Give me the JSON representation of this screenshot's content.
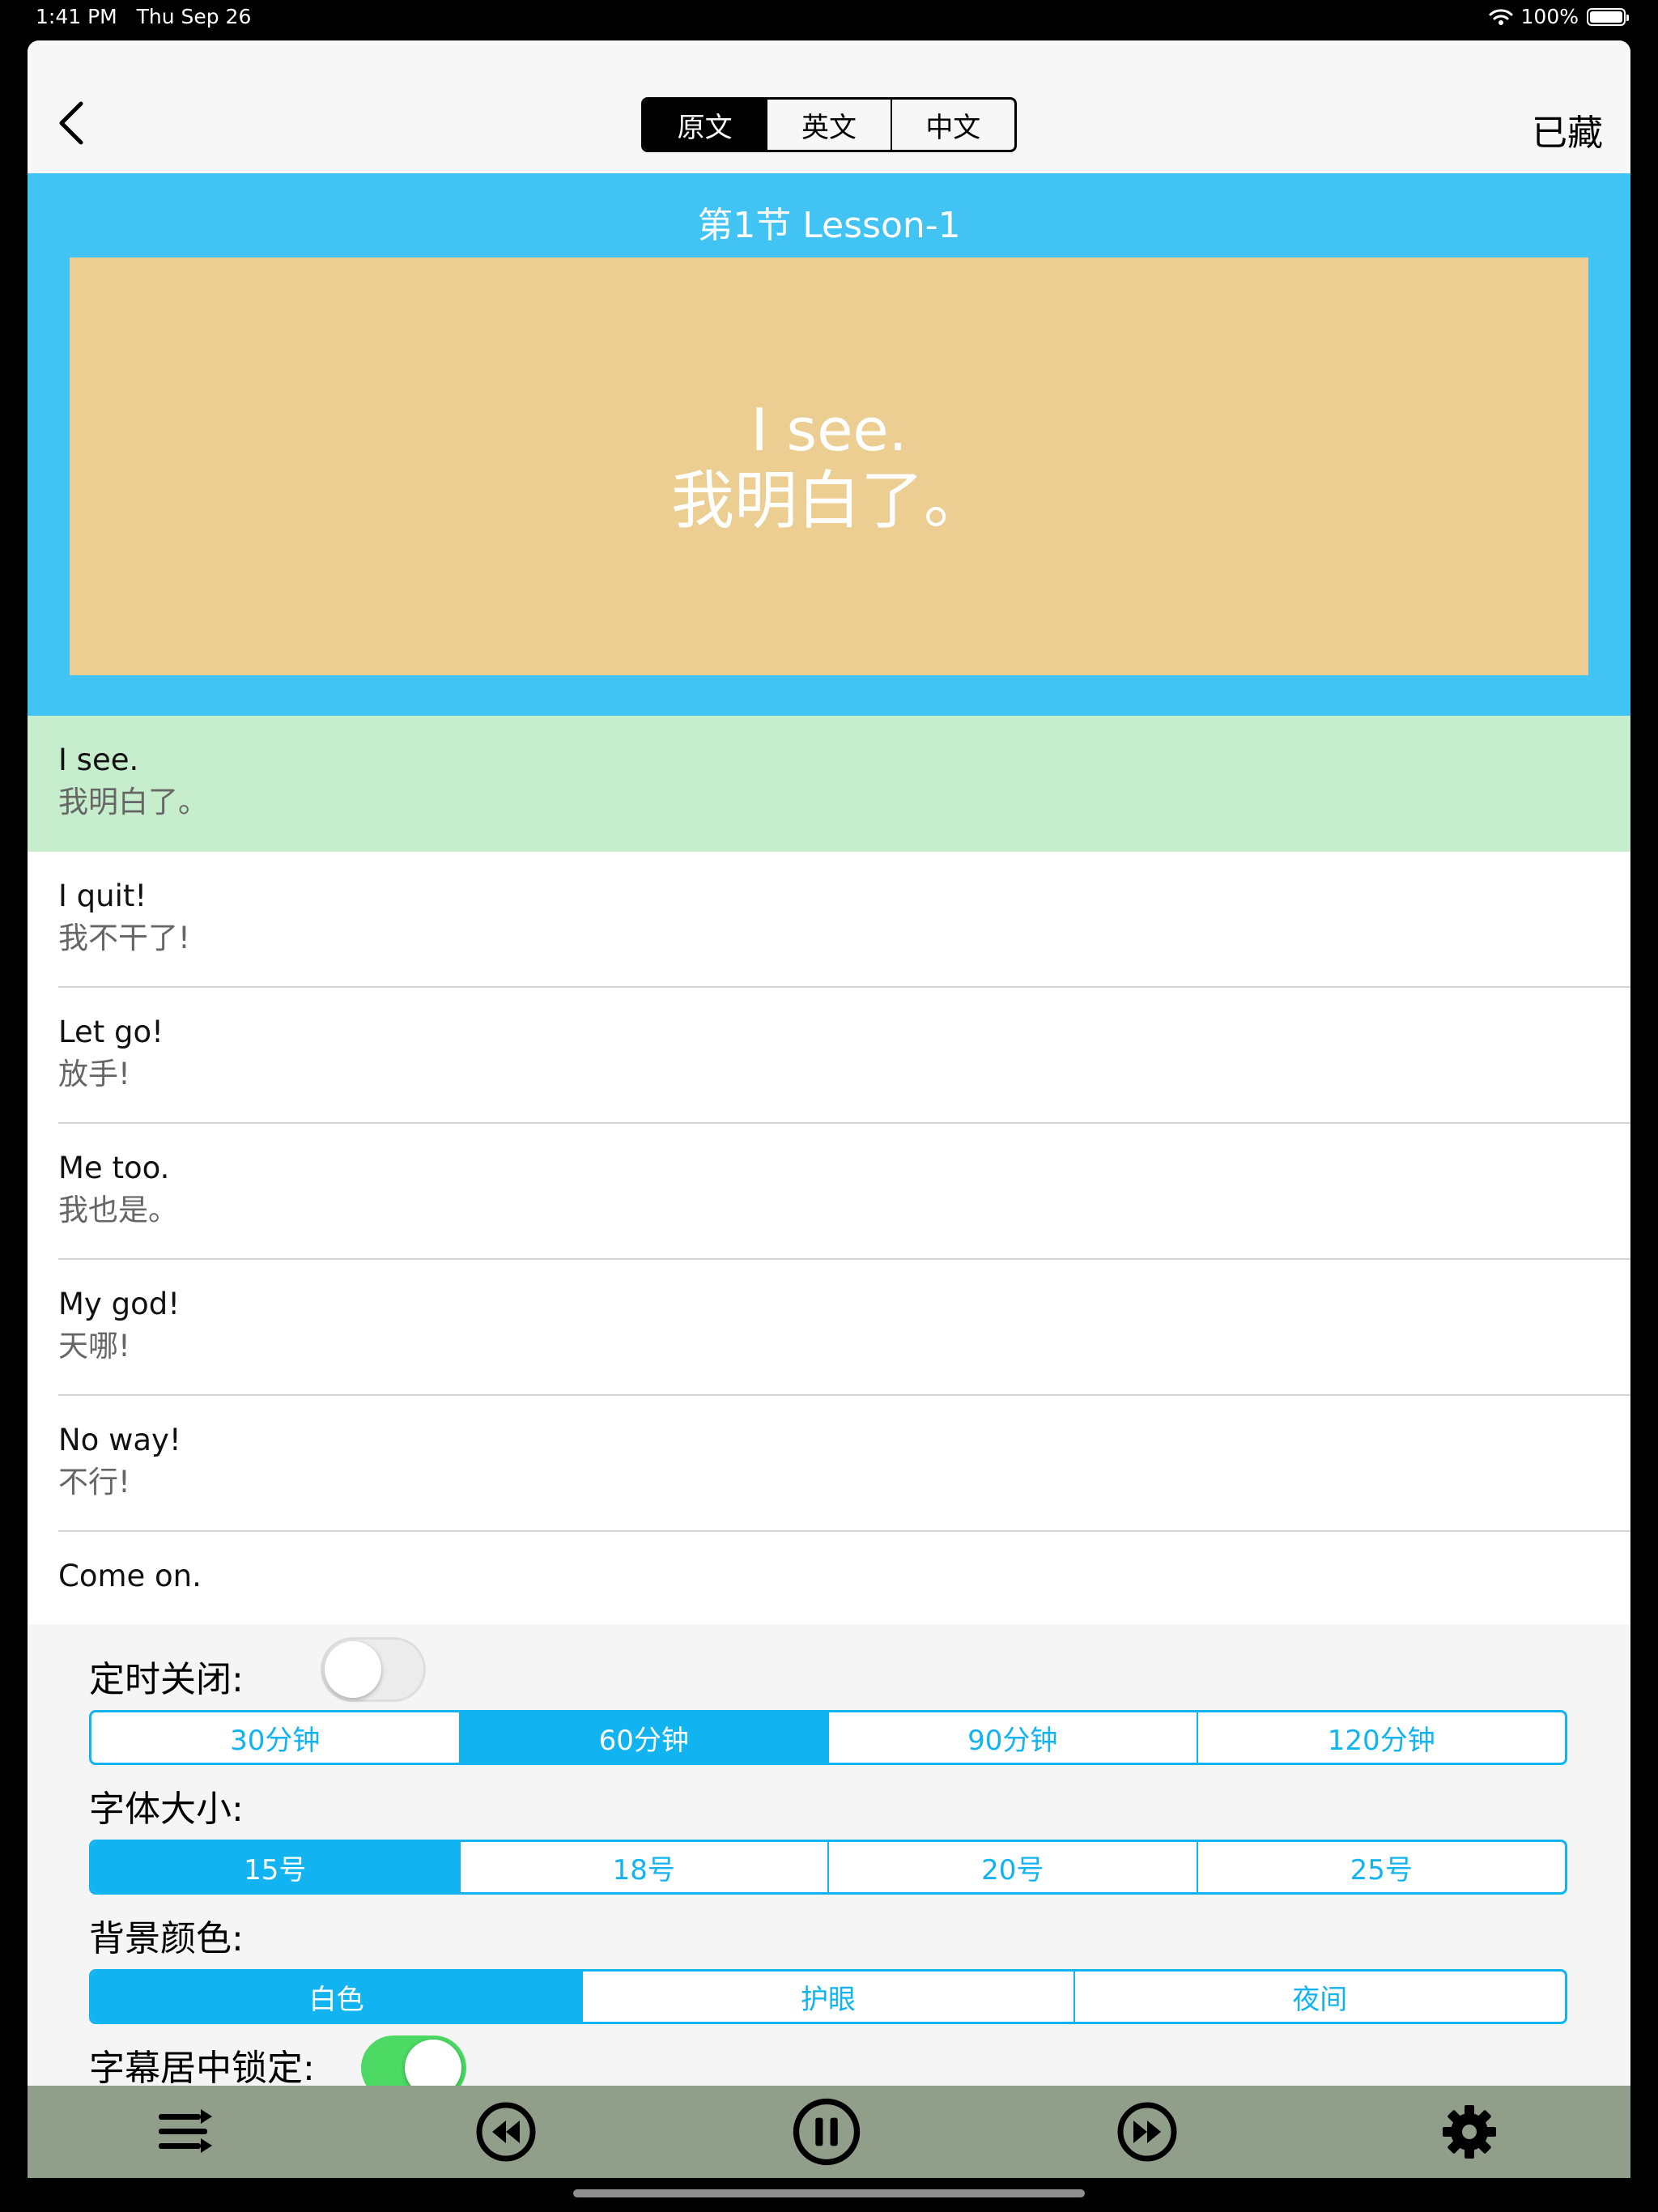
{
  "status_bar": {
    "time": "1:41 PM",
    "date": "Thu Sep 26",
    "battery": "100%"
  },
  "nav": {
    "tabs": [
      {
        "label": "原文",
        "active": true
      },
      {
        "label": "英文",
        "active": false
      },
      {
        "label": "中文",
        "active": false
      }
    ],
    "saved_label": "已藏"
  },
  "lesson": {
    "title": "第1节  Lesson-1",
    "current_subtitle": {
      "en": "I see.",
      "zh": "我明白了。"
    },
    "header_color": "#41c4f3",
    "subtitle_bg": "#ecce93"
  },
  "sentences": [
    {
      "en": "I see.",
      "zh": "我明白了。",
      "active": true
    },
    {
      "en": "I quit!",
      "zh": "我不干了!"
    },
    {
      "en": "Let go!",
      "zh": "放手!"
    },
    {
      "en": "Me too.",
      "zh": "我也是。"
    },
    {
      "en": "My god!",
      "zh": "天哪!"
    },
    {
      "en": "No way!",
      "zh": "不行!"
    },
    {
      "en": "Come on.",
      "zh": ""
    }
  ],
  "settings": {
    "timer": {
      "label": "定时关闭:",
      "enabled": false,
      "options": [
        "30分钟",
        "60分钟",
        "90分钟",
        "120分钟"
      ],
      "selected": 1
    },
    "font_size": {
      "label": "字体大小:",
      "options": [
        "15号",
        "18号",
        "20号",
        "25号"
      ],
      "selected": 0
    },
    "background": {
      "label": "背景颜色:",
      "options": [
        "白色",
        "护眼",
        "夜间"
      ],
      "selected": 0
    },
    "center_lock": {
      "label": "字幕居中锁定:",
      "enabled": true
    },
    "accent_color": "#11b4f0"
  },
  "toolbar": {
    "icons": [
      "playlist-icon",
      "rewind-icon",
      "pause-icon",
      "fast-forward-icon",
      "gear-icon"
    ],
    "bg_color": "#919e8a"
  }
}
